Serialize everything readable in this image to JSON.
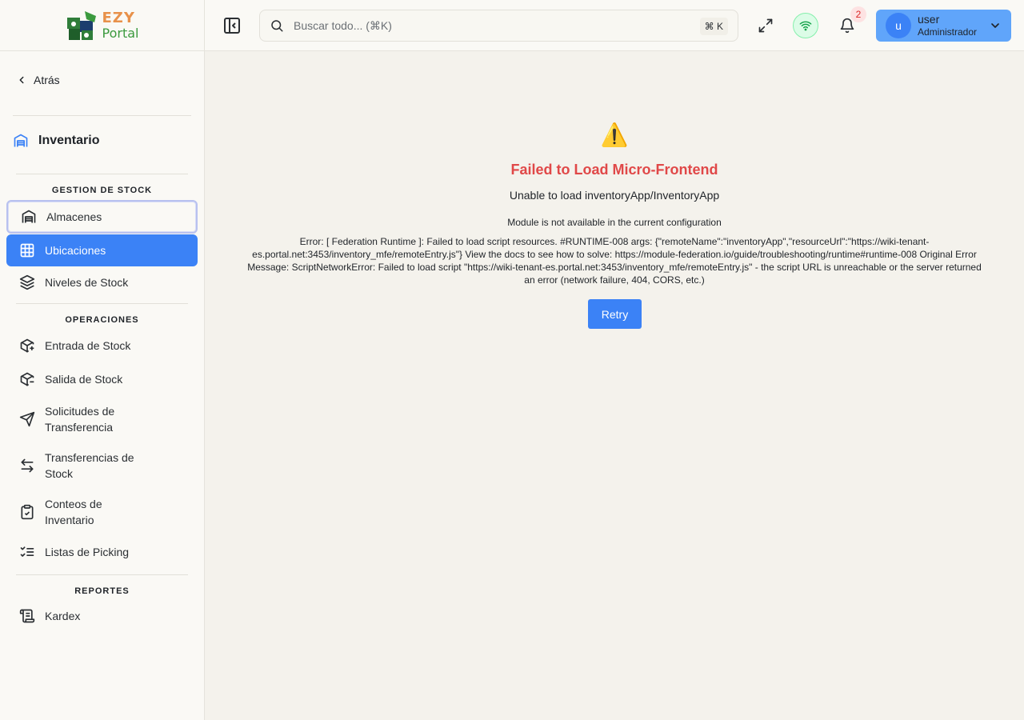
{
  "brand": {
    "line1": "EZY",
    "line2": "Portal"
  },
  "sidebar": {
    "back_label": "Atrás",
    "module_title": "Inventario",
    "sections": [
      {
        "title": "GESTION DE STOCK",
        "items": [
          {
            "label": "Almacenes",
            "icon": "warehouse-icon"
          },
          {
            "label": "Ubicaciones",
            "icon": "grid-icon"
          },
          {
            "label": "Niveles de Stock",
            "icon": "layers-icon"
          }
        ]
      },
      {
        "title": "OPERACIONES",
        "items": [
          {
            "label": "Entrada de Stock",
            "icon": "package-plus-icon"
          },
          {
            "label": "Salida de Stock",
            "icon": "package-minus-icon"
          },
          {
            "label": "Solicitudes de Transferencia",
            "icon": "send-icon"
          },
          {
            "label": "Transferencias de Stock",
            "icon": "arrows-left-right-icon"
          },
          {
            "label": "Conteos de Inventario",
            "icon": "clipboard-check-icon"
          },
          {
            "label": "Listas de Picking",
            "icon": "list-checks-icon"
          }
        ]
      },
      {
        "title": "REPORTES",
        "items": [
          {
            "label": "Kardex",
            "icon": "scroll-icon"
          }
        ]
      }
    ],
    "active_item": "Ubicaciones",
    "focused_item": "Almacenes"
  },
  "header": {
    "search_placeholder": "Buscar todo... (⌘K)",
    "shortcut": "⌘ K",
    "notifications_count": "2",
    "user": {
      "initial": "u",
      "name": "user",
      "role": "Administrador"
    }
  },
  "error": {
    "icon": "⚠️",
    "title": "Failed to Load Micro-Frontend",
    "subtitle": "Unable to load inventoryApp/InventoryApp",
    "module_message": "Module is not available in the current configuration",
    "detail": "Error: [ Federation Runtime ]: Failed to load script resources. #RUNTIME-008 args: {\"remoteName\":\"inventoryApp\",\"resourceUrl\":\"https://wiki-tenant-es.portal.net:3453/inventory_mfe/remoteEntry.js\"} View the docs to see how to solve: https://module-federation.io/guide/troubleshooting/runtime#runtime-008 Original Error Message: ScriptNetworkError: Failed to load script \"https://wiki-tenant-es.portal.net:3453/inventory_mfe/remoteEntry.js\" - the script URL is unreachable or the server returned an error (network failure, 404, CORS, etc.)",
    "retry_label": "Retry"
  },
  "colors": {
    "accent": "#3b82f6",
    "error": "#e04848",
    "online": "#16a34a"
  }
}
